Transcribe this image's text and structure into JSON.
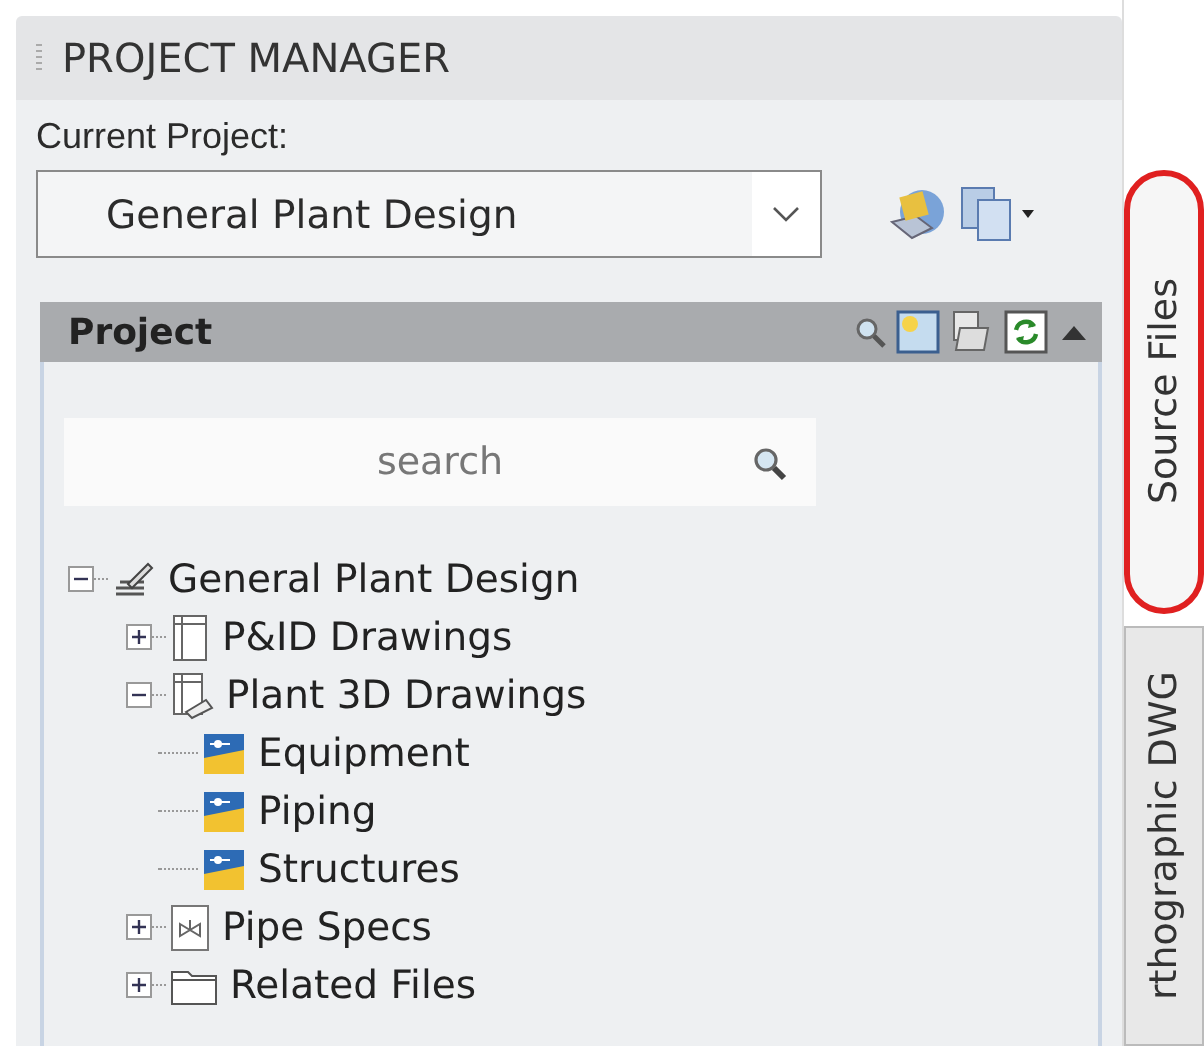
{
  "panel": {
    "title": "PROJECT MANAGER"
  },
  "current_project": {
    "label": "Current Project:",
    "value": "General Plant Design"
  },
  "project_section": {
    "title": "Project",
    "collapsed": false
  },
  "search": {
    "placeholder": "search"
  },
  "tree": [
    {
      "label": "General Plant Design",
      "kind": "project",
      "expanded": true,
      "children": [
        {
          "label": "P&ID Drawings",
          "kind": "pid",
          "expanded": false
        },
        {
          "label": "Plant 3D Drawings",
          "kind": "plant3d",
          "expanded": true,
          "children": [
            {
              "label": "Equipment",
              "kind": "drawing"
            },
            {
              "label": "Piping",
              "kind": "drawing"
            },
            {
              "label": "Structures",
              "kind": "drawing"
            }
          ]
        },
        {
          "label": "Pipe Specs",
          "kind": "specs",
          "expanded": false
        },
        {
          "label": "Related Files",
          "kind": "folder",
          "expanded": false
        }
      ]
    }
  ],
  "side_tabs": [
    {
      "label": "Source Files",
      "selected": true,
      "highlighted": true
    },
    {
      "label": "rthographic DWG",
      "selected": false,
      "highlighted": false
    }
  ]
}
